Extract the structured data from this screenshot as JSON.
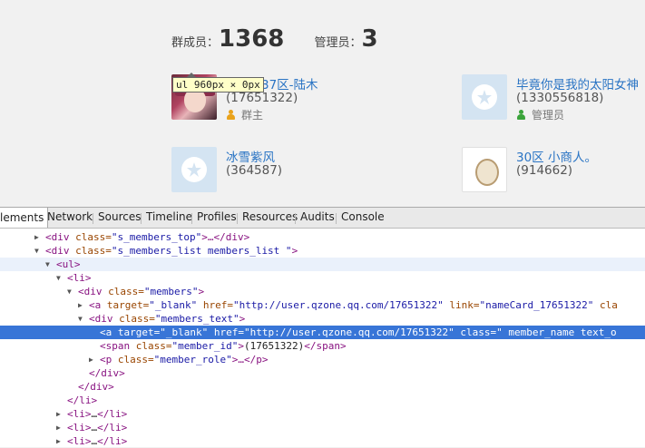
{
  "header": {
    "members_label": "群成员：",
    "members_count": "1368",
    "admins_label": "管理员：",
    "admins_count": "3"
  },
  "members": [
    {
      "name": "37区-陆木",
      "id": "(17651322)",
      "role": "群主",
      "role_type": "owner",
      "avatar": "anime-girl-photo"
    },
    {
      "name": "毕竟你是我的太阳女神",
      "id": "(1330556818)",
      "role": "管理员",
      "role_type": "admin",
      "avatar": "qzone-star-default"
    },
    {
      "name": "冰雪紫风",
      "id": "(364587)",
      "role": "",
      "role_type": "",
      "avatar": "qzone-star-default"
    },
    {
      "name": "30区 小商人。",
      "id": "(914662)",
      "role": "",
      "role_type": "",
      "avatar": "doodle-character"
    }
  ],
  "tooltip": {
    "text": "ul 960px × 0px"
  },
  "devtools": {
    "tabs": [
      "lements",
      "Network",
      "Sources",
      "Timeline",
      "Profiles",
      "Resources",
      "Audits",
      "Console"
    ],
    "active_tab": "lements"
  },
  "dom_tree": [
    {
      "tri": "▶",
      "tag_open": "<div ",
      "attr": "class=",
      "val": "\"s_members_top\"",
      "rest": ">…</div>"
    },
    {
      "tri": "▼",
      "tag_open": "<div ",
      "attr": "class=",
      "val": "\"s_members_list members_list \"",
      "rest": ">"
    },
    {
      "tri": "▼",
      "tag_open": "<ul>",
      "attr": "",
      "val": "",
      "rest": ""
    },
    {
      "tri": "▼",
      "tag_open": "<li>",
      "attr": "",
      "val": "",
      "rest": ""
    },
    {
      "tri": "▼",
      "tag_open": "<div ",
      "attr": "class=",
      "val": "\"members\"",
      "rest": ">"
    },
    {
      "tri": "▶",
      "tag_open": "<a ",
      "attr": "target=",
      "val": "\"_blank\"",
      "attr2": " href=",
      "val2": "\"http://user.qzone.qq.com/17651322\"",
      "attr3": " link=",
      "val3": "\"nameCard_17651322\"",
      "attr4": " cla",
      "val4": "",
      "rest": ""
    },
    {
      "tri": "▼",
      "tag_open": "<div ",
      "attr": "class=",
      "val": "\"members_text\"",
      "rest": ">"
    },
    {
      "tri": "",
      "tag_open": "<a ",
      "attr": "target=",
      "val": "\"_blank\"",
      "attr2": " href=",
      "val2": "\"http://user.qzone.qq.com/17651322\"",
      "attr3": " class=",
      "val3": "\" member_name text_o",
      "attr4": "",
      "val4": "",
      "rest": ""
    },
    {
      "tri": "",
      "tag_open": "<span ",
      "attr": "class=",
      "val": "\"member_id\"",
      "rest": ">",
      "text": "(17651322)",
      "close": "</span>"
    },
    {
      "tri": "▶",
      "tag_open": "<p ",
      "attr": "class=",
      "val": "\"member_role\"",
      "rest": ">…</p>"
    },
    {
      "tri": "",
      "tag_open": "</div>",
      "attr": "",
      "val": "",
      "rest": ""
    },
    {
      "tri": "",
      "tag_open": "</div>",
      "attr": "",
      "val": "",
      "rest": ""
    },
    {
      "tri": "",
      "tag_open": "</li>",
      "attr": "",
      "val": "",
      "rest": ""
    },
    {
      "tri": "▶",
      "tag_open": "<li>",
      "attr": "",
      "val": "",
      "rest": "",
      "text": "…",
      "close": "</li>"
    },
    {
      "tri": "▶",
      "tag_open": "<li>",
      "attr": "",
      "val": "",
      "rest": "",
      "text": "…",
      "close": "</li>"
    },
    {
      "tri": "▶",
      "tag_open": "<li>",
      "attr": "",
      "val": "",
      "rest": "",
      "text": "…",
      "close": "</li>"
    }
  ]
}
